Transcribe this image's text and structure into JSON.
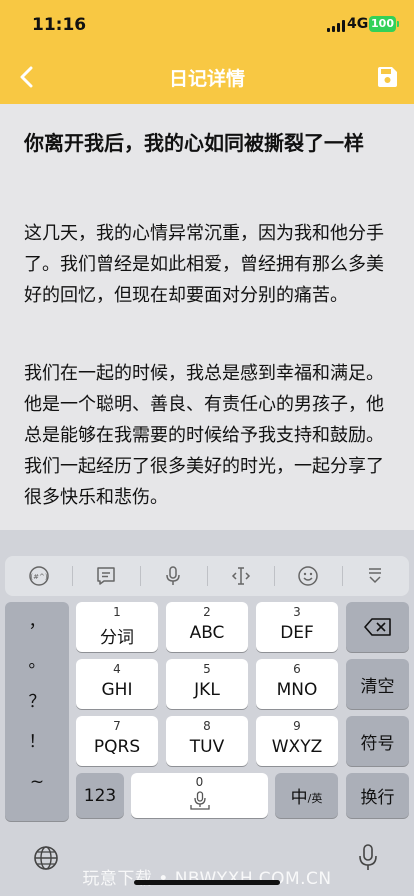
{
  "status": {
    "time": "11:16",
    "network": "4G",
    "battery": "100"
  },
  "nav": {
    "title": "日记详情"
  },
  "diary": {
    "title": "你离开我后，我的心如同被撕裂了一样",
    "paragraphs": [
      "这几天，我的心情异常沉重，因为我和他分手了。我们曾经是如此相爱，曾经拥有那么多美好的回忆，但现在却要面对分别的痛苦。",
      "我们在一起的时候，我总是感到幸福和满足。他是一个聪明、善良、有责任心的男孩子，他总是能够在我需要的时候给予我支持和鼓励。我们一起经历了很多美好的时光，一起分享了很多快乐和悲伤。"
    ]
  },
  "keyboard": {
    "toolbar": [
      "emoji-mode-icon",
      "clipboard-icon",
      "microphone-icon",
      "cursor-move-icon",
      "smiley-icon",
      "hide-keyboard-icon"
    ],
    "punctuation": [
      "，",
      "。",
      "？",
      "！",
      "~"
    ],
    "keys": [
      {
        "num": "1",
        "label": "分词"
      },
      {
        "num": "2",
        "label": "ABC"
      },
      {
        "num": "3",
        "label": "DEF"
      },
      {
        "num": "4",
        "label": "GHI"
      },
      {
        "num": "5",
        "label": "JKL"
      },
      {
        "num": "6",
        "label": "MNO"
      },
      {
        "num": "7",
        "label": "PQRS"
      },
      {
        "num": "8",
        "label": "TUV"
      },
      {
        "num": "9",
        "label": "WXYZ"
      }
    ],
    "clear": "清空",
    "symbol": "符号",
    "num_switch": "123",
    "space_num": "0",
    "lang_main": "中",
    "lang_sub": "/英",
    "return": "换行"
  },
  "watermark": "玩意下载 • NBWYXH.COM.CN"
}
